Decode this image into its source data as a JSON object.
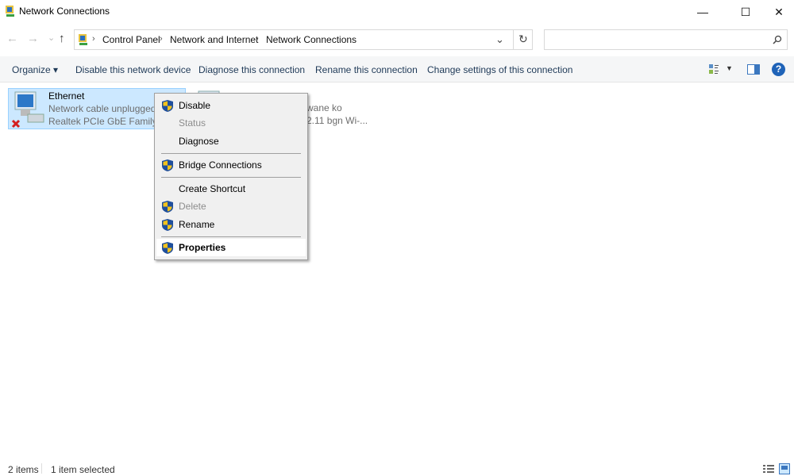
{
  "window": {
    "title": "Network Connections",
    "minimize": "—",
    "maximize": "☐",
    "close": "✕"
  },
  "nav": {
    "back": "←",
    "forward": "→",
    "recent": "⌄",
    "up": "↑",
    "refresh": "↻",
    "dropdown": "⌄",
    "breadcrumb": [
      "Control Panel",
      "Network and Internet",
      "Network Connections"
    ],
    "search_placeholder": ""
  },
  "toolbar": {
    "organize": "Organize ▾",
    "items": [
      "Disable this network device",
      "Diagnose this connection",
      "Rename this connection",
      "Change settings of this connection"
    ],
    "help": "?"
  },
  "connections": [
    {
      "name": "Ethernet",
      "status": "Network cable unplugged",
      "device": "Realtek PCIe GbE Family Cor",
      "selected": true
    },
    {
      "name": "",
      "status": "wane ko",
      "device": "2.11 bgn Wi-..."
    }
  ],
  "context_menu": {
    "items": [
      {
        "label": "Disable",
        "shield": true,
        "enabled": true
      },
      {
        "label": "Status",
        "shield": false,
        "enabled": false
      },
      {
        "label": "Diagnose",
        "shield": false,
        "enabled": true
      },
      {
        "label": "Bridge Connections",
        "shield": true,
        "enabled": true
      },
      {
        "label": "Create Shortcut",
        "shield": false,
        "enabled": true
      },
      {
        "label": "Delete",
        "shield": true,
        "enabled": false
      },
      {
        "label": "Rename",
        "shield": true,
        "enabled": true
      },
      {
        "label": "Properties",
        "shield": true,
        "enabled": true,
        "default": true
      }
    ]
  },
  "statusbar": {
    "count": "2 items",
    "selection": "1 item selected"
  }
}
